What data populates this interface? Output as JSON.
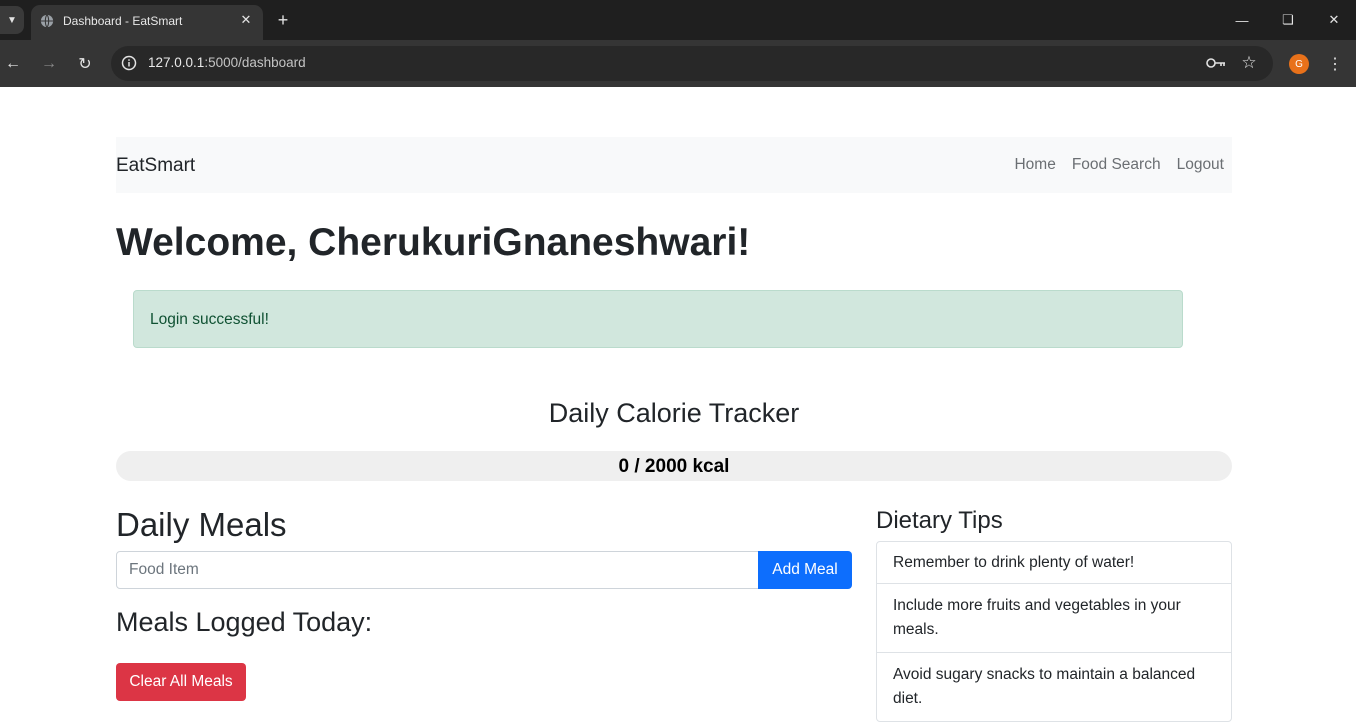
{
  "browser": {
    "tab_title": "Dashboard - EatSmart",
    "url_host": "127.0.0.1",
    "url_path": ":5000/dashboard",
    "profile_initial": "G"
  },
  "navbar": {
    "brand": "EatSmart",
    "links": [
      "Home",
      "Food Search",
      "Logout"
    ]
  },
  "welcome": "Welcome, CherukuriGnaneshwari!",
  "alert": "Login successful!",
  "tracker": {
    "title": "Daily Calorie Tracker",
    "label": "0 / 2000 kcal",
    "consumed": 0,
    "goal": 2000
  },
  "meals": {
    "title": "Daily Meals",
    "input_placeholder": "Food Item",
    "input_value": "",
    "add_button": "Add Meal",
    "logged_title": "Meals Logged Today:",
    "clear_button": "Clear All Meals"
  },
  "tips": {
    "title": "Dietary Tips",
    "items": [
      "Remember to drink plenty of water!",
      "Include more fruits and vegetables in your meals.",
      "Avoid sugary snacks to maintain a balanced diet."
    ]
  },
  "colors": {
    "primary": "#0d6efd",
    "danger": "#dc3545",
    "success_bg": "#d1e7dd",
    "success_text": "#0f5132"
  }
}
